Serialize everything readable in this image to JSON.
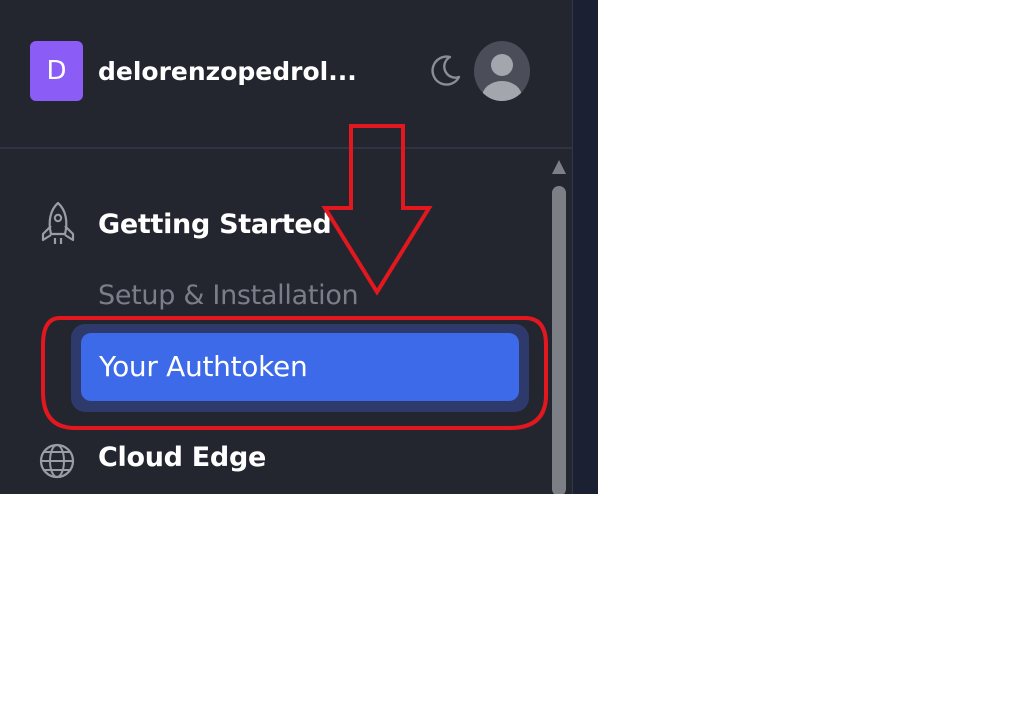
{
  "header": {
    "avatar_letter": "D",
    "username": "delorenzopedrol...",
    "theme_icon": "moon-icon",
    "profile_icon": "user-avatar-icon"
  },
  "nav": {
    "getting_started": {
      "icon": "rocket-icon",
      "label": "Getting Started",
      "children": [
        {
          "label": "Setup & Installation",
          "active": false
        },
        {
          "label": "Your Authtoken",
          "active": true
        }
      ]
    },
    "cloud_edge": {
      "icon": "globe-icon",
      "label": "Cloud Edge"
    }
  },
  "annotation": {
    "color": "#e3181f",
    "shapes": [
      "down-arrow",
      "ellipse-highlight"
    ]
  },
  "colors": {
    "sidebar_bg": "#24262f",
    "active_bg": "#3d6ae9",
    "avatar_bg": "#8b5cf6"
  }
}
